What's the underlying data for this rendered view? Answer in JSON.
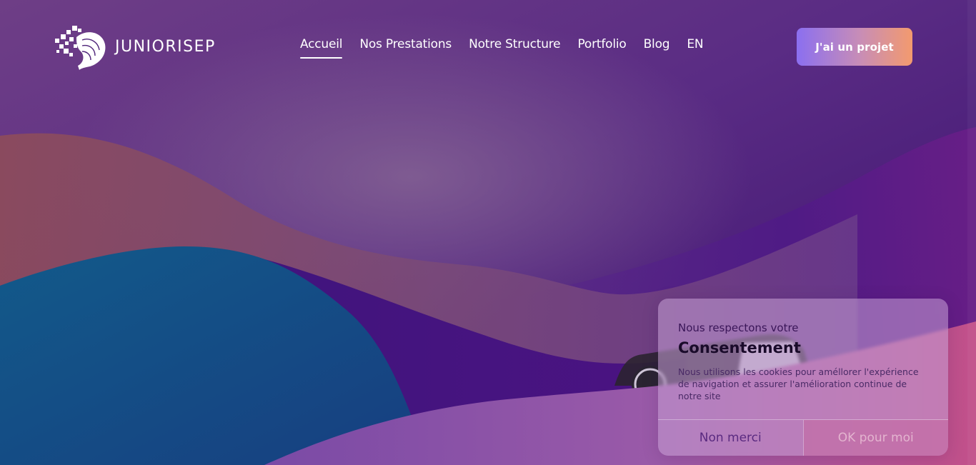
{
  "brand": {
    "name": "JUNIORISEP"
  },
  "nav": {
    "items": [
      {
        "label": "Accueil",
        "active": true
      },
      {
        "label": "Nos Prestations",
        "active": false
      },
      {
        "label": "Notre Structure",
        "active": false
      },
      {
        "label": "Portfolio",
        "active": false
      },
      {
        "label": "Blog",
        "active": false
      },
      {
        "label": "EN",
        "active": false
      }
    ],
    "cta_label": "J'ai un projet"
  },
  "consent": {
    "intro": "Nous respectons votre",
    "title": "Consentement",
    "text": "Nous utilisons les cookies pour améllorer l'expérience de navigation et assurer l'amélioration continue de notre site",
    "decline_label": "Non merci",
    "accept_label": "OK pour moi"
  },
  "colors": {
    "cta_gradient_start": "#8b6ff0",
    "cta_gradient_end": "#f39a6e",
    "background_base": "#3f1470"
  },
  "icons": {
    "logo": "junior-isep-logo-icon",
    "hero_device": "device-icon"
  }
}
